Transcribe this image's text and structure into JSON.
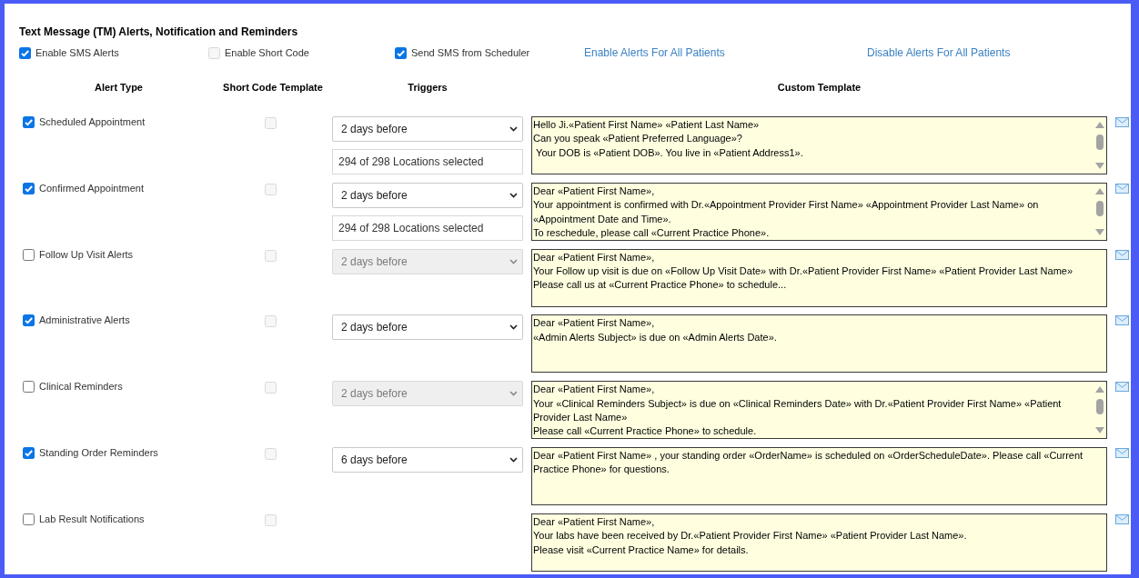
{
  "title": "Text Message (TM) Alerts, Notification and Reminders",
  "settings": [
    {
      "label": "Enable SMS Alerts",
      "checked": true,
      "disabled": false
    },
    {
      "label": "Enable Short Code",
      "checked": false,
      "disabled": true
    },
    {
      "label": "Send SMS from Scheduler",
      "checked": true,
      "disabled": false
    }
  ],
  "links": [
    "Enable Alerts For All Patients",
    "Disable Alerts For All Patients"
  ],
  "columns": [
    "Alert Type",
    "Short Code Template",
    "Triggers",
    "Custom Template"
  ],
  "alerts": [
    {
      "name": "Scheduled Appointment",
      "checked": true,
      "short_code": {
        "checked": false,
        "disabled": true
      },
      "trigger": {
        "value": "2 days before",
        "disabled": false
      },
      "locations": "294 of 298 Locations selected",
      "template": {
        "kind": "scrolling",
        "text": "Hello Ji.«Patient First Name» «Patient Last Name»\nCan you speak «Patient Preferred Language»?\n Your DOB is «Patient DOB». You live in «Patient Address1»."
      }
    },
    {
      "name": "Confirmed Appointment",
      "checked": true,
      "short_code": {
        "checked": false,
        "disabled": true
      },
      "trigger": {
        "value": "2 days before",
        "disabled": false
      },
      "locations": "294 of 298 Locations selected",
      "template": {
        "kind": "scrolling",
        "text": "Dear «Patient First Name»,\nYour appointment is confirmed with Dr.«Appointment Provider First Name» «Appointment Provider Last Name» on «Appointment Date and Time».\nTo reschedule, please call «Current Practice Phone»."
      }
    },
    {
      "name": "Follow Up Visit Alerts",
      "checked": false,
      "short_code": {
        "checked": false,
        "disabled": true
      },
      "trigger": {
        "value": "2 days before",
        "disabled": true
      },
      "template": {
        "kind": "plain",
        "text": "Dear «Patient First Name»,\nYour Follow up visit is due on «Follow Up Visit Date» with Dr.«Patient Provider First Name» «Patient Provider Last Name»\nPlease call us at «Current Practice Phone» to schedule..."
      }
    },
    {
      "name": "Administrative Alerts",
      "checked": true,
      "short_code": {
        "checked": false,
        "disabled": true
      },
      "trigger": {
        "value": "2 days before",
        "disabled": false
      },
      "template": {
        "kind": "plain",
        "text": "Dear «Patient First Name»,\n«Admin Alerts Subject» is due on «Admin Alerts Date»."
      }
    },
    {
      "name": "Clinical Reminders",
      "checked": false,
      "short_code": {
        "checked": false,
        "disabled": true
      },
      "trigger": {
        "value": "2 days before",
        "disabled": true
      },
      "template": {
        "kind": "scrolling",
        "text": "Dear «Patient First Name»,\nYour «Clinical Reminders Subject» is due on «Clinical Reminders Date» with Dr.«Patient Provider First Name» «Patient Provider Last Name»\nPlease call «Current Practice Phone» to schedule."
      }
    },
    {
      "name": "Standing Order Reminders",
      "checked": true,
      "short_code": {
        "checked": false,
        "disabled": true
      },
      "trigger": {
        "value": "6 days before",
        "disabled": false
      },
      "template": {
        "kind": "plain",
        "text": "Dear «Patient First Name» , your standing order «OrderName» is scheduled on «OrderScheduleDate». Please call «Current Practice Phone» for questions."
      }
    },
    {
      "name": "Lab Result Notifications",
      "checked": false,
      "short_code": {
        "checked": false,
        "disabled": true
      },
      "template": {
        "kind": "plain",
        "text": "Dear «Patient First Name»,\nYour labs have been received by Dr.«Patient Provider First Name» «Patient Provider Last Name».\nPlease visit «Current Practice Name» for details."
      }
    }
  ]
}
